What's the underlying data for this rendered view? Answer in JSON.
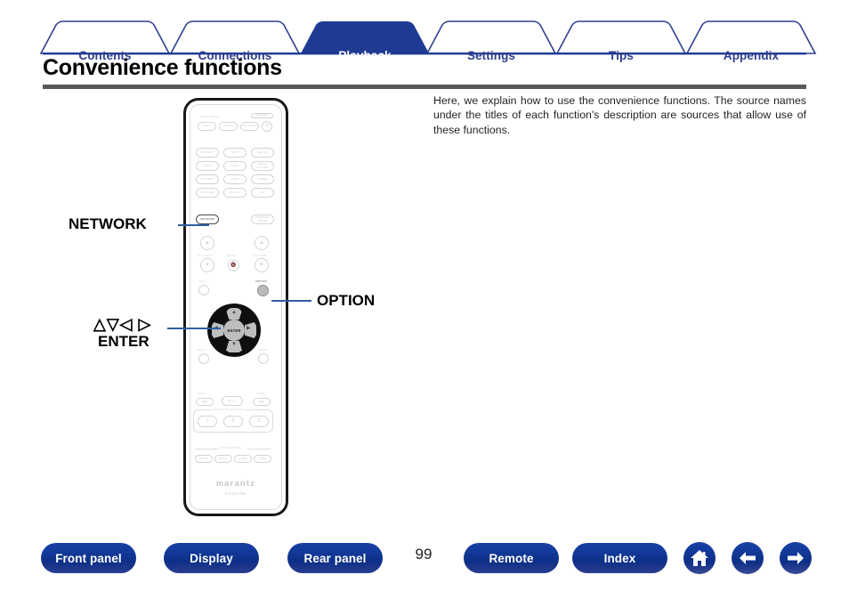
{
  "tabs": [
    {
      "label": "Contents",
      "active": false
    },
    {
      "label": "Connections",
      "active": false
    },
    {
      "label": "Playback",
      "active": true
    },
    {
      "label": "Settings",
      "active": false
    },
    {
      "label": "Tips",
      "active": false
    },
    {
      "label": "Appendix",
      "active": false
    }
  ],
  "header": {
    "title": "Convenience functions"
  },
  "main": {
    "intro": "Here, we explain how to use the convenience functions. The source names under the titles of each function's description are sources that allow use of these functions."
  },
  "callouts": {
    "network": "NETWORK",
    "cursor": "△▽◁ ▷",
    "enter": "ENTER",
    "option": "OPTION"
  },
  "remote": {
    "zone_select_label": "ZONE SELECT",
    "power_label": "POWER",
    "zone_buttons": [
      "MAIN",
      "ZONE2",
      "ALL ZONE"
    ],
    "power_button": "⏻",
    "source_buttons": [
      "CBL/SAT",
      "DVD",
      "Blu-ray",
      "GAME",
      "AUX1",
      "MEDIA PLAYER",
      "TV AUDIO",
      "AUX2",
      "TUNER",
      "iPod/USB",
      "M-XPort",
      "CD",
      "NETWORK",
      "INTERNET RADIO"
    ],
    "highlighted_source": "NETWORK",
    "ch_page_label": "CH / PAGE",
    "mute_label": "MUTE",
    "volume_label": "VOLUME",
    "info_label": "INFO",
    "option_label": "OPTION",
    "back_label": "BACK",
    "setup_label": "SETUP",
    "enter_label": "ENTER",
    "tune_minus": "TUNE −",
    "tune_plus": "TUNE +",
    "transport": [
      "◀◀",
      "▶ / Ⅱ",
      "▶▶"
    ],
    "favorite_station_label": "FAVORITE STATION",
    "favorite_buttons": [
      "1",
      "2",
      "3"
    ],
    "sound_mode_label": "SOUND MODE",
    "sound_mode_buttons": [
      "MOVIE",
      "MUSIC",
      "GAME",
      "PURE"
    ],
    "brand": "marantz",
    "model": "RC021SR"
  },
  "footer": {
    "buttons": [
      {
        "label": "Front panel"
      },
      {
        "label": "Display"
      },
      {
        "label": "Rear panel"
      },
      {
        "label": "Remote"
      },
      {
        "label": "Index"
      }
    ],
    "icons": [
      {
        "name": "home-icon"
      },
      {
        "name": "arrow-left-icon"
      },
      {
        "name": "arrow-right-icon"
      }
    ],
    "page_number": "99"
  },
  "colors": {
    "brand_blue": "#1f3a93",
    "tab_blue": "#2e3f8f",
    "rule_gray": "#58595b",
    "leader_blue": "#2e5fa3"
  }
}
